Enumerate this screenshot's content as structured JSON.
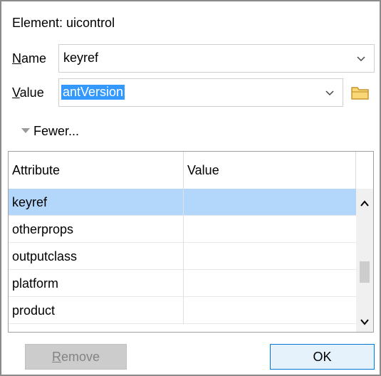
{
  "element_label": "Element: uicontrol",
  "name_field": {
    "label_accel": "N",
    "label_rest": "ame",
    "value": "keyref",
    "chevron_icon": "chevron-down-icon"
  },
  "value_field": {
    "label_accel": "V",
    "label_rest": "alue",
    "value": "antVersion",
    "chevron_icon": "chevron-down-icon",
    "browse_icon": "folder-icon"
  },
  "toggle": {
    "label": "Fewer..."
  },
  "table": {
    "columns": [
      "Attribute",
      "Value"
    ],
    "rows": [
      {
        "attribute": "keyref",
        "value": "",
        "selected": true
      },
      {
        "attribute": "otherprops",
        "value": ""
      },
      {
        "attribute": "outputclass",
        "value": ""
      },
      {
        "attribute": "platform",
        "value": ""
      },
      {
        "attribute": "product",
        "value": ""
      }
    ]
  },
  "buttons": {
    "remove_accel": "R",
    "remove_rest": "emove",
    "ok": "OK"
  },
  "colors": {
    "selection": "#3399ff",
    "row_selected": "#b3d7fb",
    "ok_border": "#0078d7"
  }
}
